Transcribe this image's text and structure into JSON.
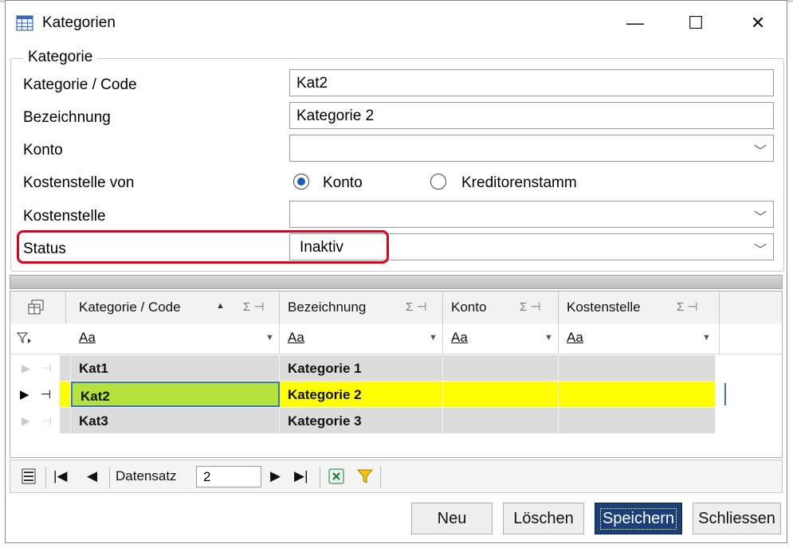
{
  "window": {
    "title": "Kategorien",
    "minimize": "—",
    "maximize": "☐",
    "close": "✕"
  },
  "group": {
    "label": "Kategorie"
  },
  "form": {
    "code_label": "Kategorie / Code",
    "code_value": "Kat2",
    "name_label": "Bezeichnung",
    "name_value": "Kategorie 2",
    "konto_label": "Konto",
    "konto_value": "",
    "ks_von_label": "Kostenstelle von",
    "radio_konto": "Konto",
    "radio_kreditor": "Kreditorenstamm",
    "radio_selected": "Konto",
    "ks_label": "Kostenstelle",
    "ks_value": "",
    "status_label": "Status",
    "status_value": "Inaktiv"
  },
  "grid": {
    "columns": [
      "Kategorie / Code",
      "Bezeichnung",
      "Konto",
      "Kostenstelle"
    ],
    "sigma": "Σ",
    "filter_placeholder": "Aa",
    "sort_indicator": "▲",
    "rows": [
      {
        "code": "Kat1",
        "name": "Kategorie 1",
        "konto": "",
        "ks": ""
      },
      {
        "code": "Kat2",
        "name": "Kategorie 2",
        "konto": "",
        "ks": ""
      },
      {
        "code": "Kat3",
        "name": "Kategorie 3",
        "konto": "",
        "ks": ""
      }
    ],
    "selected_row": 1,
    "colors": {
      "selected_code": "#b5e23c",
      "selected_row": "#ffff00",
      "row": "#dcdcdc"
    }
  },
  "navigator": {
    "record_label": "Datensatz",
    "record_value": "2"
  },
  "buttons": {
    "new": "Neu",
    "delete": "Löschen",
    "save": "Speichern",
    "close": "Schliessen"
  },
  "accent": {
    "highlight": "#e0001a",
    "primary_button": "#1c3f78"
  }
}
